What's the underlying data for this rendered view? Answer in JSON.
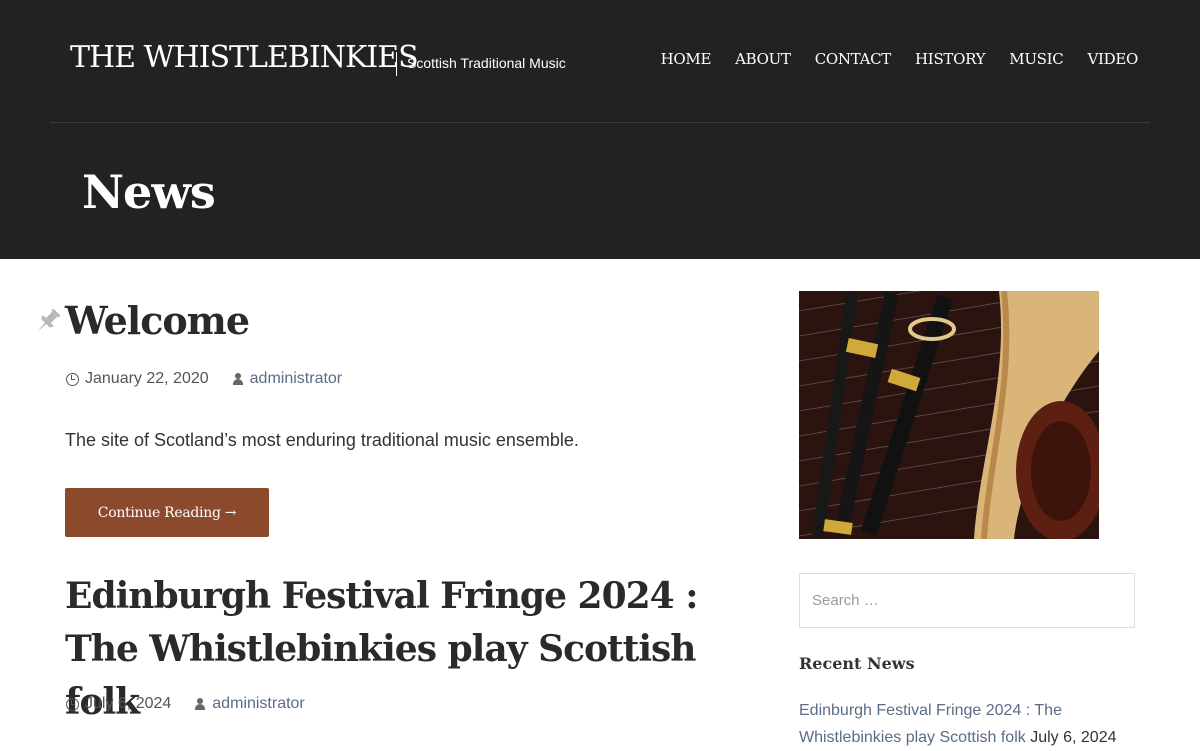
{
  "header": {
    "site_title": "THE WHISTLEBINKIES",
    "tagline": "Scottish Traditional Music",
    "nav": [
      "HOME",
      "ABOUT",
      "CONTACT",
      "HISTORY",
      "MUSIC",
      "VIDEO"
    ],
    "page_title": "News"
  },
  "posts": [
    {
      "title": "Welcome",
      "date": "January 22, 2020",
      "author": "administrator",
      "excerpt": "The site of Scotland’s most enduring traditional music ensemble.",
      "button_label": "Continue Reading →",
      "sticky": true
    },
    {
      "title": "Edinburgh Festival Fringe 2024 : The Whistlebinkies play Scottish folk",
      "date": "July 6, 2024",
      "author": "administrator"
    }
  ],
  "sidebar": {
    "search_placeholder": "Search …",
    "recent_title": "Recent News",
    "recent": [
      {
        "title": "Edinburgh Festival Fringe 2024 : The Whistlebinkies play Scottish folk",
        "date": "July 6, 2024"
      }
    ]
  },
  "colors": {
    "header_bg": "#222222",
    "accent_button": "#8b4a2b",
    "link": "#5a6d85"
  },
  "icons": [
    "pushpin-icon",
    "clock-icon",
    "user-icon",
    "instruments-image"
  ]
}
